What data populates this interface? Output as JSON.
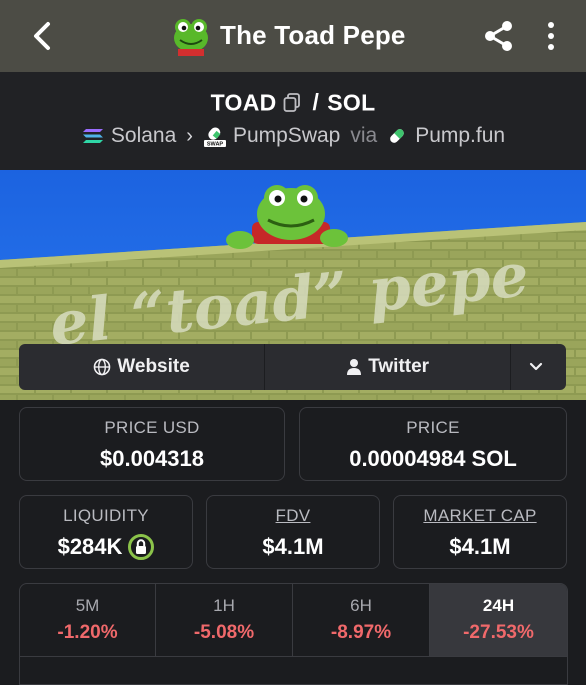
{
  "header": {
    "title": "The Toad Pepe",
    "back_icon": "chevron-left-icon",
    "share_icon": "share-icon",
    "more_icon": "vertical-dots-icon"
  },
  "pair": {
    "base": "TOAD",
    "separator": "/",
    "quote": "SOL",
    "chain": "Solana",
    "dex": "PumpSwap",
    "via_label": "via",
    "launchpad": "Pump.fun"
  },
  "banner": {
    "text": "el “toad” pepe"
  },
  "links": {
    "website": "Website",
    "twitter": "Twitter"
  },
  "stats": {
    "price_usd_label": "PRICE USD",
    "price_usd": "$0.004318",
    "price_label": "PRICE",
    "price": "0.00004984 SOL",
    "liquidity_label": "LIQUIDITY",
    "liquidity": "$284K",
    "fdv_label": "FDV",
    "fdv": "$4.1M",
    "mcap_label": "MARKET CAP",
    "mcap": "$4.1M"
  },
  "timeframes": [
    {
      "label": "5M",
      "change": "-1.20%"
    },
    {
      "label": "1H",
      "change": "-5.08%"
    },
    {
      "label": "6H",
      "change": "-8.97%"
    },
    {
      "label": "24H",
      "change": "-27.53%"
    }
  ],
  "colors": {
    "negative": "#f0696b",
    "header_bg": "#4c4c45",
    "page_bg": "#1b1c1f",
    "lock_ring": "#8bc34a"
  }
}
